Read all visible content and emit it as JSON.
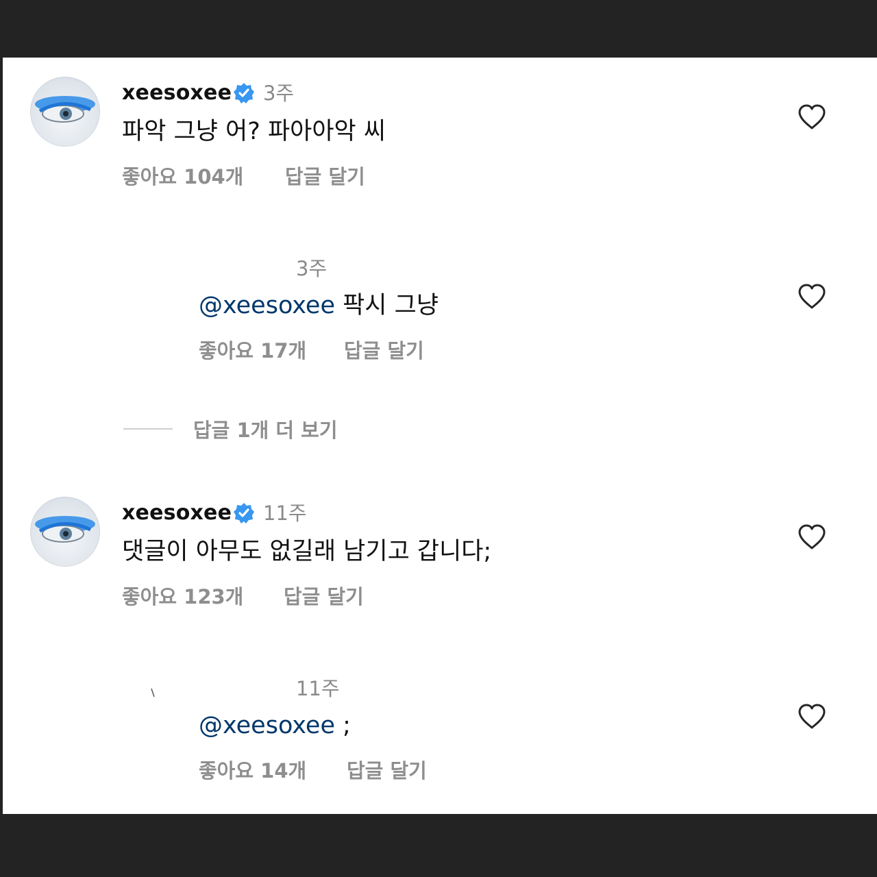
{
  "comments": [
    {
      "username": "xeesoxee",
      "time": "3주",
      "text": "파악 그냥 어? 파아아악 씨",
      "likes": "좋아요 104개",
      "reply": "답글 달기"
    },
    {
      "time": "3주",
      "mention": "@xeesoxee",
      "text": " 팍시 그냥",
      "likes": "좋아요 17개",
      "reply": "답글 달기"
    },
    {
      "username": "xeesoxee",
      "time": "11주",
      "text": "댓글이 아무도 없길래 남기고 갑니다;",
      "likes": "좋아요 123개",
      "reply": "답글 달기"
    },
    {
      "time": "11주",
      "mention": "@xeesoxee",
      "text": " ;",
      "likes": "좋아요 14개",
      "reply": "답글 달기"
    }
  ],
  "view_more_replies": "답글 1개 더 보기",
  "icons": {
    "verified": "verified-badge-icon",
    "like": "heart-outline-icon"
  },
  "colors": {
    "verified_blue": "#3897f0",
    "mention": "#00376b",
    "muted": "#8e8e8e",
    "frame": "#232323"
  }
}
